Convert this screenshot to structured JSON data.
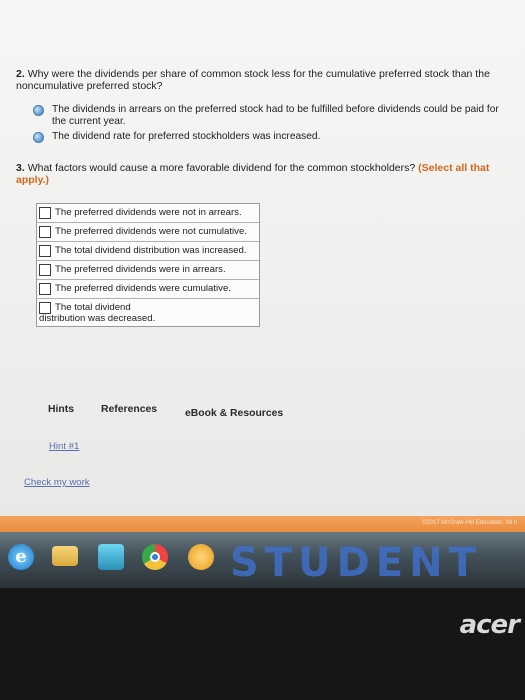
{
  "question2": {
    "number": "2.",
    "text": "Why were the dividends per share of common stock less for the cumulative preferred stock than the noncumulative preferred stock?",
    "options": [
      "The dividends in arrears on the preferred stock had to be fulfilled before dividends could be paid for the current year.",
      "The dividend rate for preferred stockholders was increased."
    ]
  },
  "question3": {
    "number": "3.",
    "text": "What factors would cause a more favorable dividend for the common stockholders?",
    "instruction": "(Select all that apply.)",
    "options": [
      "The preferred dividends were not in arrears.",
      "The preferred dividends were not cumulative.",
      "The total dividend distribution was increased.",
      "The preferred dividends were in arrears.",
      "The preferred dividends were cumulative.",
      "The total dividend distribution was decreased."
    ]
  },
  "tabs": {
    "hints": "Hints",
    "references": "References",
    "ebook": "eBook & Resources"
  },
  "links": {
    "hint1": "Hint #1",
    "check": "Check my work"
  },
  "footer": {
    "watermark": "©2017 McGraw-Hill Education. All ri",
    "banner": "STUDENT",
    "brand": "acer"
  },
  "colors": {
    "accent": "#d2691e",
    "link": "#5a6fb0",
    "orange_bar": "#e98c3c"
  },
  "icons": [
    "radio-icon",
    "checkbox-icon",
    "ie-icon",
    "folder-icon",
    "media-icon",
    "chrome-icon",
    "orb-icon"
  ]
}
